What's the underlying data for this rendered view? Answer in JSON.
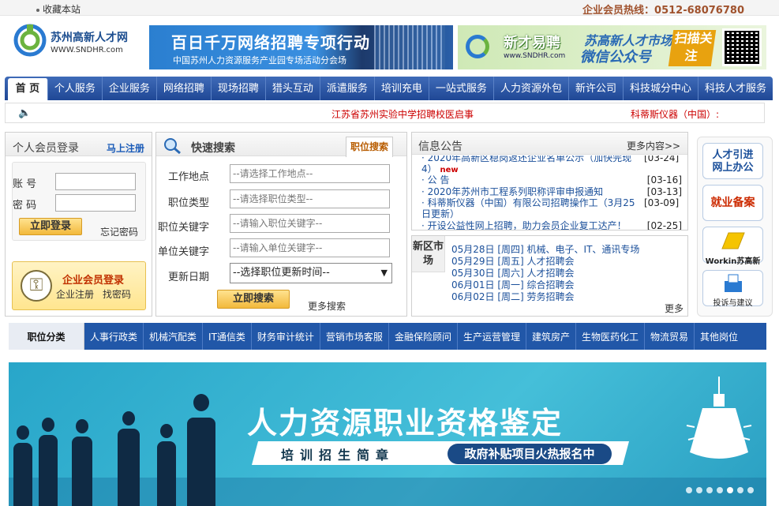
{
  "topbar": {
    "favorite": "收藏本站",
    "hotline": "企业会员热线：0512-68076780"
  },
  "header": {
    "logo_name": "苏州高新人才网",
    "logo_url": "WWW.SNDHR.com",
    "banner1": {
      "title": "百日千万网络招聘专项行动",
      "subtitle": "中国苏州人力资源服务产业园专场活动分会场"
    },
    "banner2": {
      "brand": "新才易聘",
      "url": "www.SNDHR.com",
      "title1": "苏高新人才市场",
      "title2": "微信公众号",
      "scan": "扫描关注"
    }
  },
  "nav": [
    "首 页",
    "个人服务",
    "企业服务",
    "网络招聘",
    "现场招聘",
    "猎头互动",
    "派遣服务",
    "培训充电",
    "一站式服务",
    "人力资源外包",
    "新许公司",
    "科技城分中心",
    "科技人才服务"
  ],
  "ticker": {
    "item1": "江苏省苏州实验中学招聘校医启事",
    "item2": "科蒂斯仪器（中国）:"
  },
  "login": {
    "title": "个人会员登录",
    "register": "马上注册",
    "account_label": "账 号",
    "password_label": "密 码",
    "submit": "立即登录",
    "forgot": "忘记密码",
    "enterprise_title": "企业会员登录",
    "enterprise_register": "企业注册",
    "enterprise_find": "找密码"
  },
  "search": {
    "title": "快速搜索",
    "tab": "职位搜索",
    "fields": [
      {
        "label": "工作地点",
        "placeholder": "--请选择工作地点--"
      },
      {
        "label": "职位类型",
        "placeholder": "--请选择职位类型--"
      },
      {
        "label": "职位关键字",
        "placeholder": "--请输入职位关键字--"
      },
      {
        "label": "单位关键字",
        "placeholder": "--请输入单位关键字--"
      }
    ],
    "date_label": "更新日期",
    "date_value": "--选择职位更新时间--",
    "submit": "立即搜索",
    "more": "更多搜索"
  },
  "info": {
    "title": "信息公告",
    "more": "更多内容>>",
    "items": [
      {
        "text": "2020年高新区稳岗返还企业名单公示（加快完现 4）",
        "new": "new",
        "date": "[03-24]"
      },
      {
        "text": "公 告",
        "new": "",
        "date": "[03-16]"
      },
      {
        "text": "2020年苏州市工程系列职称评审申报通知",
        "new": "",
        "date": "[03-13]"
      },
      {
        "text": "科蒂斯仪器（中国）有限公司招聘操作工（3月25日更新）",
        "new": "",
        "date": "[03-09]"
      },
      {
        "text": "开设公益性网上招聘，助力会员企业复工达产！",
        "new": "",
        "date": "[02-25]"
      }
    ]
  },
  "market": {
    "tag": "新区市场",
    "more": "更多",
    "items": [
      "05月28日 [周四] 机械、电子、IT、通讯专场",
      "05月29日 [周五] 人才招聘会",
      "05月30日 [周六] 人才招聘会",
      "06月01日 [周一] 综合招聘会",
      "06月02日 [周二] 劳务招聘会"
    ]
  },
  "side": {
    "b1a": "人才引进",
    "b1b": "网上办公",
    "b2": "就业备案",
    "b3": "Workin苏高新",
    "b4": "投诉与建议"
  },
  "categories": [
    "职位分类",
    "人事行政类",
    "机械汽配类",
    "IT通信类",
    "财务审计统计",
    "营销市场客服",
    "金融保险顾问",
    "生产运营管理",
    "建筑房产",
    "生物医药化工",
    "物流贸易",
    "其他岗位"
  ],
  "hero": {
    "title": "人力资源职业资格鉴定",
    "subtitle": "培训招生简章",
    "pill": "政府补贴项目火热报名中"
  },
  "colors": {
    "nav": "#2a56a3",
    "accent": "#cc0000",
    "hero": "#35b0d0"
  }
}
